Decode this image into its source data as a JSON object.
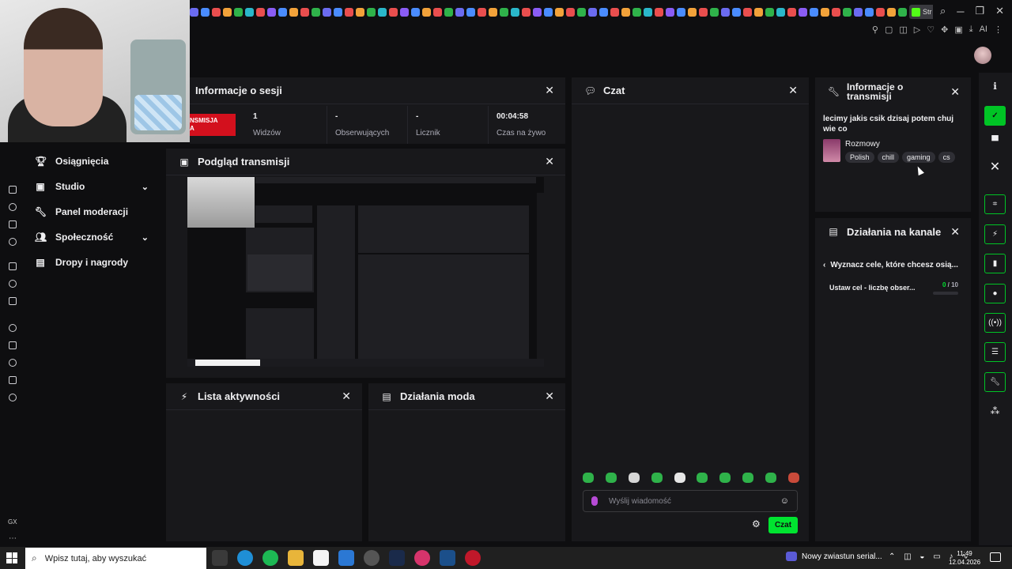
{
  "browser": {
    "tab_colors": [
      "#6b6bf0",
      "#4a8cff",
      "#e94e4e",
      "#f2a23a",
      "#2fb24a",
      "#2ab7ca",
      "#e94e4e",
      "#8a5cf5",
      "#4a8cff",
      "#f2a23a",
      "#e94e4e",
      "#2fb24a",
      "#6b6bf0",
      "#4a8cff",
      "#e94e4e",
      "#f2a23a",
      "#2fb24a",
      "#2ab7ca",
      "#e94e4e",
      "#8a5cf5",
      "#4a8cff",
      "#f2a23a",
      "#e94e4e",
      "#2fb24a",
      "#6b6bf0",
      "#4a8cff",
      "#e94e4e",
      "#f2a23a",
      "#2fb24a",
      "#2ab7ca",
      "#e94e4e",
      "#8a5cf5",
      "#4a8cff",
      "#f2a23a",
      "#e94e4e",
      "#2fb24a",
      "#6b6bf0",
      "#4a8cff",
      "#e94e4e",
      "#f2a23a",
      "#2fb24a",
      "#2ab7ca",
      "#e94e4e",
      "#8a5cf5",
      "#4a8cff",
      "#f2a23a",
      "#e94e4e",
      "#2fb24a",
      "#6b6bf0",
      "#4a8cff",
      "#e94e4e",
      "#f2a23a",
      "#2fb24a",
      "#2ab7ca",
      "#e94e4e",
      "#8a5cf5",
      "#4a8cff",
      "#f2a23a",
      "#e94e4e",
      "#2fb24a",
      "#6b6bf0",
      "#4a8cff",
      "#e94e4e",
      "#f2a23a",
      "#2fb24a",
      "#2ab7ca",
      "#e94e4e",
      "#8a5cf5",
      "#4a8cff",
      "#f2a23a",
      "#e94e4e",
      "#2fb24a",
      "#6b6bf0",
      "#4a8cff"
    ],
    "active_tab_label": "Str",
    "toolbar_ai_label": "AI"
  },
  "left_nav": {
    "items": [
      {
        "icon": "trophy-icon",
        "label": "Osiągnięcia",
        "expandable": false
      },
      {
        "icon": "video-icon",
        "label": "Studio",
        "expandable": true
      },
      {
        "icon": "wrench-icon",
        "label": "Panel moderacji",
        "expandable": false
      },
      {
        "icon": "people-icon",
        "label": "Społeczność",
        "expandable": true
      },
      {
        "icon": "gift-icon",
        "label": "Dropy i nagrody",
        "expandable": false
      }
    ],
    "rail_label": "GX"
  },
  "session": {
    "title": "Informacje o sesji",
    "live_badge": "NSMISJA\nA",
    "stats": [
      {
        "value": "1",
        "label": "Widzów"
      },
      {
        "value": "-",
        "label": "Obserwujących"
      },
      {
        "value": "-",
        "label": "Licznik"
      },
      {
        "value": "00:04:58",
        "label": "Czas na żywo"
      }
    ]
  },
  "preview": {
    "title": "Podgląd transmisji"
  },
  "activity": {
    "title": "Lista aktywności"
  },
  "mod_actions": {
    "title": "Działania moda"
  },
  "chat": {
    "title": "Czat",
    "input_placeholder": "Wyślij wiadomość",
    "send_label": "Czat"
  },
  "stream_info": {
    "title": "Informacje o transmisji",
    "stream_title": "lecimy jakis csik dzisaj potem chuj wie co",
    "category": "Rozmowy",
    "tags": [
      "Polish",
      "chill",
      "gaming",
      "cs"
    ]
  },
  "channel_actions": {
    "title": "Działania na kanale",
    "goal_back_label": "Wyznacz cele, które chcesz osią...",
    "goal_item_label": "Ustaw cel - liczbę obser...",
    "goal_current": "0",
    "goal_total": "/ 10",
    "goal_progress": 0
  },
  "taskbar": {
    "search_placeholder": "Wpisz tutaj, aby wyszukać",
    "notification": "Nowy zwiastun serial...",
    "time": "11:49",
    "date": "12.04.2026"
  }
}
